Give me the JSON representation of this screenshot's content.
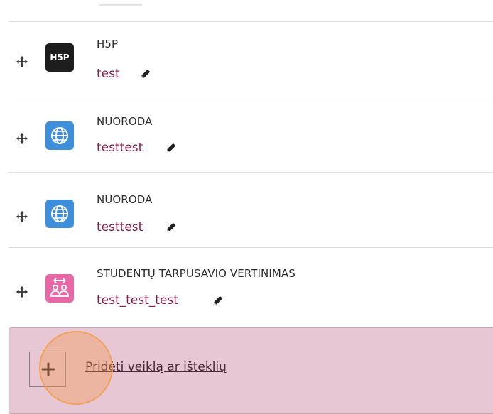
{
  "activities": [
    {
      "type": "H5P",
      "name": "test",
      "icon": "h5p-icon"
    },
    {
      "type": "NUORODA",
      "name": "testtest",
      "icon": "globe-icon"
    },
    {
      "type": "NUORODA",
      "name": "testtest",
      "icon": "globe-icon"
    },
    {
      "type": "STUDENTŲ TARPUSAVIO VERTINIMAS",
      "name": "test_test_test",
      "icon": "peer-assessment-icon"
    }
  ],
  "h5p_logo_text": "H5P",
  "add_activity": {
    "label": "Pridėti veiklą ar išteklių"
  },
  "colors": {
    "link": "#8a1f4b",
    "url_icon_bg": "#3d8fdc",
    "peer_icon_bg": "#e868a6",
    "add_area_bg": "#e7c7d3"
  }
}
